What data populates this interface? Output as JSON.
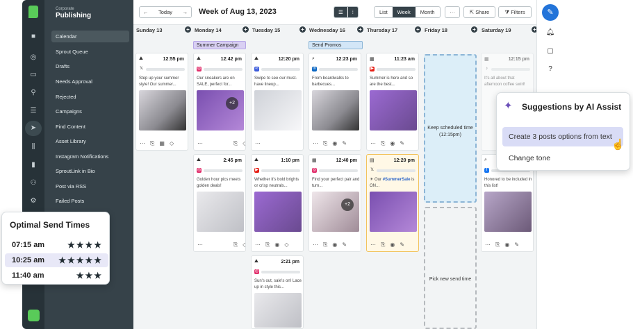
{
  "app": {
    "org": "Corporate",
    "title": "Publishing"
  },
  "rail_icons": [
    "publishing-icon",
    "compass-icon",
    "inbox-icon",
    "pin-icon",
    "list-icon",
    "send-icon",
    "waveform-icon",
    "bar-chart-icon",
    "people-icon",
    "gear-icon"
  ],
  "sidebar": {
    "items": [
      "Calendar",
      "Sprout Queue",
      "Drafts",
      "Needs Approval",
      "Rejected",
      "Campaigns",
      "Find Content",
      "Asset Library",
      "Instagram Notifications",
      "SproutLink in Bio",
      "Post via RSS",
      "Failed Posts"
    ],
    "active": "Calendar"
  },
  "toolbar": {
    "prev": "←",
    "today": "Today",
    "next": "→",
    "week_title": "Week of Aug 13, 2023",
    "views": [
      "List",
      "Week",
      "Month"
    ],
    "active_view": "Week",
    "more": "···",
    "share": "Share",
    "filters": "Filters"
  },
  "days": [
    "Sunday 13",
    "Monday 14",
    "Tuesday 15",
    "Wednesday 16",
    "Thursday 17",
    "Friday 18",
    "Saturday 19"
  ],
  "tags": {
    "summer": "Summer Campaign",
    "promos": "Send Promos"
  },
  "posts": {
    "sun1": {
      "time": "12:55 pm",
      "network": "X",
      "text": "Step up your summer style! Our summer..."
    },
    "mon1": {
      "time": "12:42 pm",
      "network": "instagram",
      "text": "Our sneakers are on SALE, perfect for...",
      "more": "+2"
    },
    "mon2": {
      "time": "2:45 pm",
      "network": "instagram",
      "text": "Golden hour pics meets golden deals!"
    },
    "tue1": {
      "time": "12:20 pm",
      "network": "meta",
      "text": "Swipe to see our must-have lineup..."
    },
    "tue2": {
      "time": "1:10 pm",
      "network": "youtube",
      "text": "Whether it's bold brights or crisp neutrals..."
    },
    "tue3": {
      "time": "2:21 pm",
      "network": "instagram",
      "text": "Sun's out, sale's on! Lace up in style this..."
    },
    "wed1": {
      "time": "12:23 pm",
      "network": "linkedin",
      "text": "From boardwalks to barbecues..."
    },
    "wed2": {
      "time": "12:40 pm",
      "network": "instagram",
      "text": "Find your perfect pair and turn...",
      "more": "+2"
    },
    "thu1": {
      "time": "11:23 am",
      "network": "youtube",
      "text": "Summer is here and so are the best..."
    },
    "thu2": {
      "time": "12:20 pm",
      "network": "X",
      "text_pre": "Our ",
      "hashtag": "#SummerSale",
      "text_post": " is ON..."
    },
    "sat1": {
      "time": "12:15 pm",
      "network": "tiktok",
      "text": "It's all about that afternoon coffee swirl!"
    },
    "sat2": {
      "network": "facebook",
      "text": "Honored to be included in this list!"
    }
  },
  "friday": {
    "keep": "Keep scheduled time (12:15pm)",
    "pick": "Pick new send time"
  },
  "optimal": {
    "title": "Optimal Send Times",
    "rows": [
      {
        "time": "07:15 am",
        "stars": "★★★★"
      },
      {
        "time": "10:25 am",
        "stars": "★★★★★"
      },
      {
        "time": "11:40 am",
        "stars": "★★★"
      }
    ],
    "highlight_index": 1
  },
  "ai": {
    "title": "Suggestions by AI Assist",
    "options": [
      "Create 3 posts options from text",
      "Change tone"
    ]
  },
  "colors": {
    "accent_blue": "#2374d9",
    "brand_green": "#59cb59",
    "sidebar": "#364249",
    "tag_purple": "#d9d0f3",
    "tag_blue": "#d3e6f7"
  }
}
